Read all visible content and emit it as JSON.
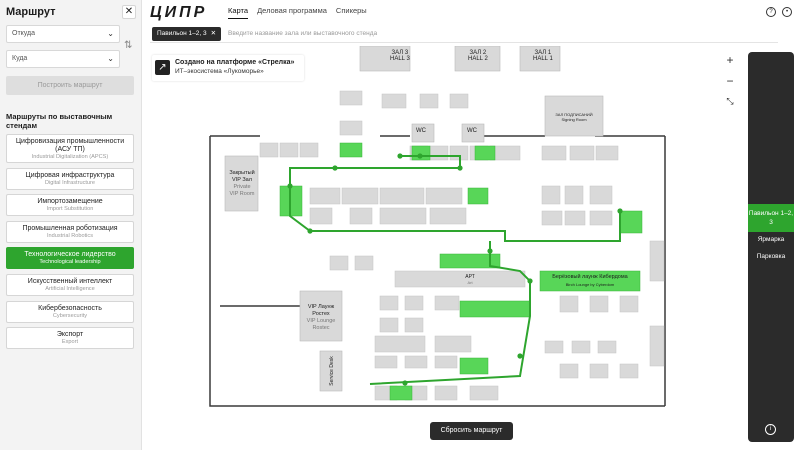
{
  "sidebar": {
    "title": "Маршрут",
    "from_placeholder": "Откуда",
    "to_placeholder": "Куда",
    "build_label": "Построить маршрут",
    "section_title": "Маршруты по выставочным стендам",
    "routes": [
      {
        "label": "Цифровизация промышленности (АСУ ТП)",
        "sub": "Industrial Digitalization (APCS)",
        "active": false
      },
      {
        "label": "Цифровая инфраструктура",
        "sub": "Digital Infrastructure",
        "active": false
      },
      {
        "label": "Импортозамещение",
        "sub": "Import Substitution",
        "active": false
      },
      {
        "label": "Промышленная роботизация",
        "sub": "Industrial Robotics",
        "active": false
      },
      {
        "label": "Технологическое лидерство",
        "sub": "Technological leadership",
        "active": true
      },
      {
        "label": "Искусственный интеллект",
        "sub": "Artificial Intelligence",
        "active": false
      },
      {
        "label": "Кибербезопасность",
        "sub": "Cybersecurity",
        "active": false
      },
      {
        "label": "Экспорт",
        "sub": "Export",
        "active": false
      }
    ]
  },
  "header": {
    "logo": "ЦИПР",
    "tabs": [
      {
        "label": "Карта",
        "active": true
      },
      {
        "label": "Деловая программа",
        "active": false
      },
      {
        "label": "Спикеры",
        "active": false
      }
    ]
  },
  "search": {
    "chip_label": "Павильон 1–2, 3",
    "placeholder": "Введите название зала или выставочного стенда"
  },
  "promo": {
    "line1": "Создано на платформе «Стрелка»",
    "line2": "ИТ–экосистема «Лукоморье»"
  },
  "map": {
    "halls": [
      {
        "line1": "ЗАЛ 3",
        "line2": "HALL 3"
      },
      {
        "line1": "ЗАЛ 2",
        "line2": "HALL 2"
      },
      {
        "line1": "ЗАЛ 1",
        "line2": "HALL 1"
      }
    ],
    "closed_vip": {
      "line1": "Закрытый",
      "line2": "VIP Зал",
      "line3": "Private",
      "line4": "VIP Room"
    },
    "signing": {
      "line1": "ЗАЛ ПОДПИСАНИЙ",
      "line2": "Signing Room"
    },
    "wc": "WC",
    "art": {
      "line1": "АРТ",
      "line2": "Art"
    },
    "vip_lounge": {
      "line1": "VIP Лаунж",
      "line2": "Ростех",
      "line3": "VIP Lounge",
      "line4": "Rostec"
    },
    "cyber_lounge": {
      "line1": "Берёзовый лаунж Кибердома",
      "line2": "Birch Lounge by Cyberdom"
    },
    "service_desk": "Service Desk"
  },
  "reset_label": "Сбросить маршрут",
  "pavilions": [
    {
      "label": "Павильон 1–2, 3",
      "active": true
    },
    {
      "label": "Ярмарка",
      "active": false
    },
    {
      "label": "Парковка",
      "active": false
    }
  ],
  "colors": {
    "accent": "#2ea52e",
    "dark": "#2b2b2b",
    "booth": "#d9d9d9"
  }
}
